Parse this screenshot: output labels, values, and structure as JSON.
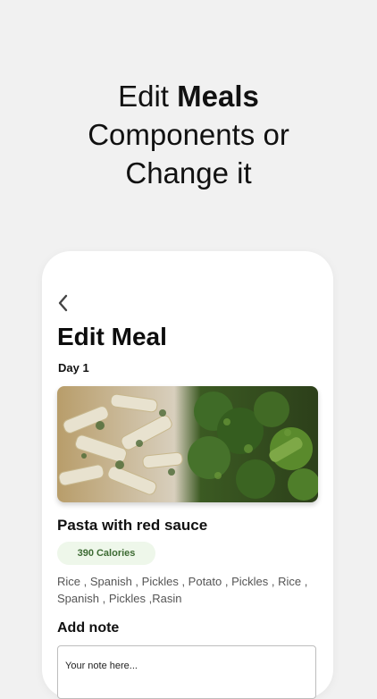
{
  "promo": {
    "line1_regular": "Edit ",
    "line1_bold": "Meals",
    "line2": "Components or",
    "line3": "Change it"
  },
  "screen": {
    "back_icon": "chevron-left-icon",
    "title": "Edit Meal",
    "day_label": "Day 1",
    "meal": {
      "name": "Pasta with red sauce",
      "calories": "390 Calories",
      "components_line1": "Rice , Spanish , Pickles , Potato , Pickles , Rice ,",
      "components_line2": "Spanish , Pickles ,Rasin"
    },
    "note": {
      "label": "Add note",
      "placeholder": "Your note here..."
    }
  },
  "colors": {
    "background": "#f1f1f1",
    "card": "#ffffff",
    "calorie_badge_bg": "#eef7ea",
    "calorie_badge_text": "#3d6b33"
  }
}
